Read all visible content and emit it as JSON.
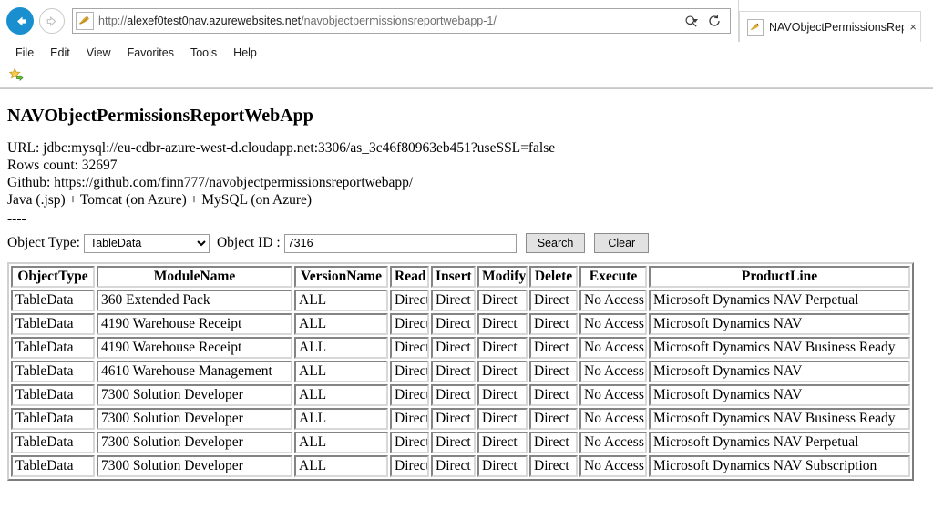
{
  "browser": {
    "back_label": "Back",
    "forward_label": "Forward",
    "address": {
      "scheme": "http://",
      "host": "alexef0test0nav.azurewebsites.net",
      "path": "/navobjectpermissionsreportwebapp-1/",
      "full": "http://alexef0test0nav.azurewebsites.net/navobjectpermissionsreportwebapp-1/",
      "favicon": "tomcat-icon"
    },
    "search_icon": "search-icon",
    "refresh_icon": "refresh-icon",
    "tabs": [
      {
        "title": "NAVObjectPermissionsRepo...",
        "favicon": "tomcat-icon",
        "close": "×"
      }
    ],
    "menu": [
      "File",
      "Edit",
      "View",
      "Favorites",
      "Tools",
      "Help"
    ],
    "favorites_bar": {
      "star_icon": "favorites-star-icon"
    }
  },
  "page": {
    "title": "NAVObjectPermissionsReportWebApp",
    "info_lines": [
      "URL: jdbc:mysql://eu-cdbr-azure-west-d.cloudapp.net:3306/as_3c46f80963eb451?useSSL=false",
      "Rows count: 32697",
      "Github: https://github.com/finn777/navobjectpermissionsreportwebapp/",
      "Java (.jsp) + Tomcat (on Azure) + MySQL (on Azure)"
    ],
    "divider": "----",
    "form": {
      "object_type_label": "Object Type:",
      "object_type_value": "TableData",
      "object_type_options": [
        "TableData"
      ],
      "object_id_label": "Object ID :",
      "object_id_value": "7316",
      "object_id_placeholder": "",
      "search_label": "Search",
      "clear_label": "Clear"
    },
    "table": {
      "columns": [
        "ObjectType",
        "ModuleName",
        "VersionName",
        "Read",
        "Insert",
        "Modify",
        "Delete",
        "Execute",
        "ProductLine"
      ],
      "rows": [
        [
          "TableData",
          "360 Extended Pack",
          "ALL",
          "Direct",
          "Direct",
          "Direct",
          "Direct",
          "No Access",
          "Microsoft Dynamics NAV Perpetual"
        ],
        [
          "TableData",
          "4190 Warehouse Receipt",
          "ALL",
          "Direct",
          "Direct",
          "Direct",
          "Direct",
          "No Access",
          "Microsoft Dynamics NAV"
        ],
        [
          "TableData",
          "4190 Warehouse Receipt",
          "ALL",
          "Direct",
          "Direct",
          "Direct",
          "Direct",
          "No Access",
          "Microsoft Dynamics NAV Business Ready"
        ],
        [
          "TableData",
          "4610 Warehouse Management",
          "ALL",
          "Direct",
          "Direct",
          "Direct",
          "Direct",
          "No Access",
          "Microsoft Dynamics NAV"
        ],
        [
          "TableData",
          "7300 Solution Developer",
          "ALL",
          "Direct",
          "Direct",
          "Direct",
          "Direct",
          "No Access",
          "Microsoft Dynamics NAV"
        ],
        [
          "TableData",
          "7300 Solution Developer",
          "ALL",
          "Direct",
          "Direct",
          "Direct",
          "Direct",
          "No Access",
          "Microsoft Dynamics NAV Business Ready"
        ],
        [
          "TableData",
          "7300 Solution Developer",
          "ALL",
          "Direct",
          "Direct",
          "Direct",
          "Direct",
          "No Access",
          "Microsoft Dynamics NAV Perpetual"
        ],
        [
          "TableData",
          "7300 Solution Developer",
          "ALL",
          "Direct",
          "Direct",
          "Direct",
          "Direct",
          "No Access",
          "Microsoft Dynamics NAV Subscription"
        ]
      ]
    }
  },
  "colors": {
    "back_button_blue": "#1a8fd0",
    "page_background": "#ffffff",
    "button_face": "#e2e2e2",
    "text": "#000000",
    "url_gray": "#6d6d6d"
  }
}
